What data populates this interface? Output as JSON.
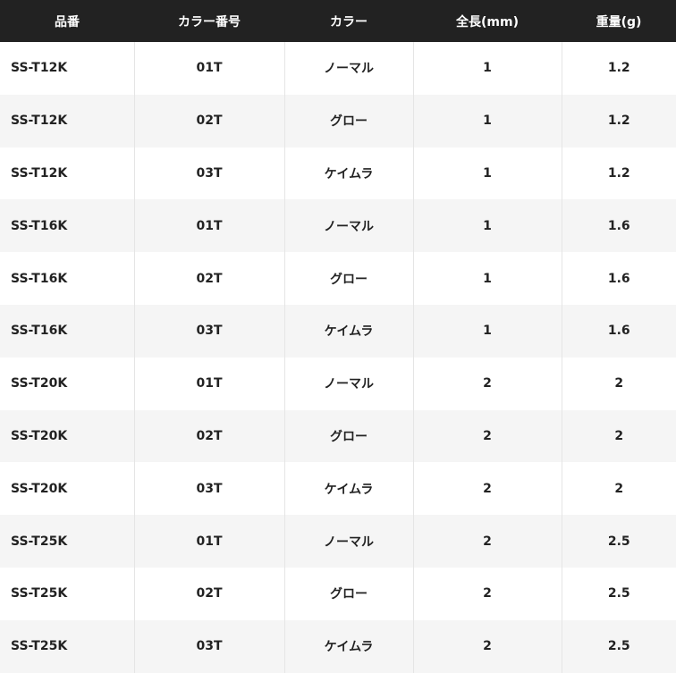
{
  "table": {
    "headers": {
      "model": "品番",
      "color_code": "カラー番号",
      "color": "カラー",
      "length": "全長(mm)",
      "weight": "重量(g)"
    },
    "rows": [
      {
        "model": "SS-T12K",
        "color_code": "01T",
        "color": "ノーマル",
        "length": "1",
        "weight": "1.2"
      },
      {
        "model": "SS-T12K",
        "color_code": "02T",
        "color": "グロー",
        "length": "1",
        "weight": "1.2"
      },
      {
        "model": "SS-T12K",
        "color_code": "03T",
        "color": "ケイムラ",
        "length": "1",
        "weight": "1.2"
      },
      {
        "model": "SS-T16K",
        "color_code": "01T",
        "color": "ノーマル",
        "length": "1",
        "weight": "1.6"
      },
      {
        "model": "SS-T16K",
        "color_code": "02T",
        "color": "グロー",
        "length": "1",
        "weight": "1.6"
      },
      {
        "model": "SS-T16K",
        "color_code": "03T",
        "color": "ケイムラ",
        "length": "1",
        "weight": "1.6"
      },
      {
        "model": "SS-T20K",
        "color_code": "01T",
        "color": "ノーマル",
        "length": "2",
        "weight": "2"
      },
      {
        "model": "SS-T20K",
        "color_code": "02T",
        "color": "グロー",
        "length": "2",
        "weight": "2"
      },
      {
        "model": "SS-T20K",
        "color_code": "03T",
        "color": "ケイムラ",
        "length": "2",
        "weight": "2"
      },
      {
        "model": "SS-T25K",
        "color_code": "01T",
        "color": "ノーマル",
        "length": "2",
        "weight": "2.5"
      },
      {
        "model": "SS-T25K",
        "color_code": "02T",
        "color": "グロー",
        "length": "2",
        "weight": "2.5"
      },
      {
        "model": "SS-T25K",
        "color_code": "03T",
        "color": "ケイムラ",
        "length": "2",
        "weight": "2.5"
      }
    ]
  },
  "colors": {
    "header_bg": "#222222",
    "header_text": "#ffffff",
    "row_alt_bg": "#f5f5f5",
    "text": "#222222"
  }
}
